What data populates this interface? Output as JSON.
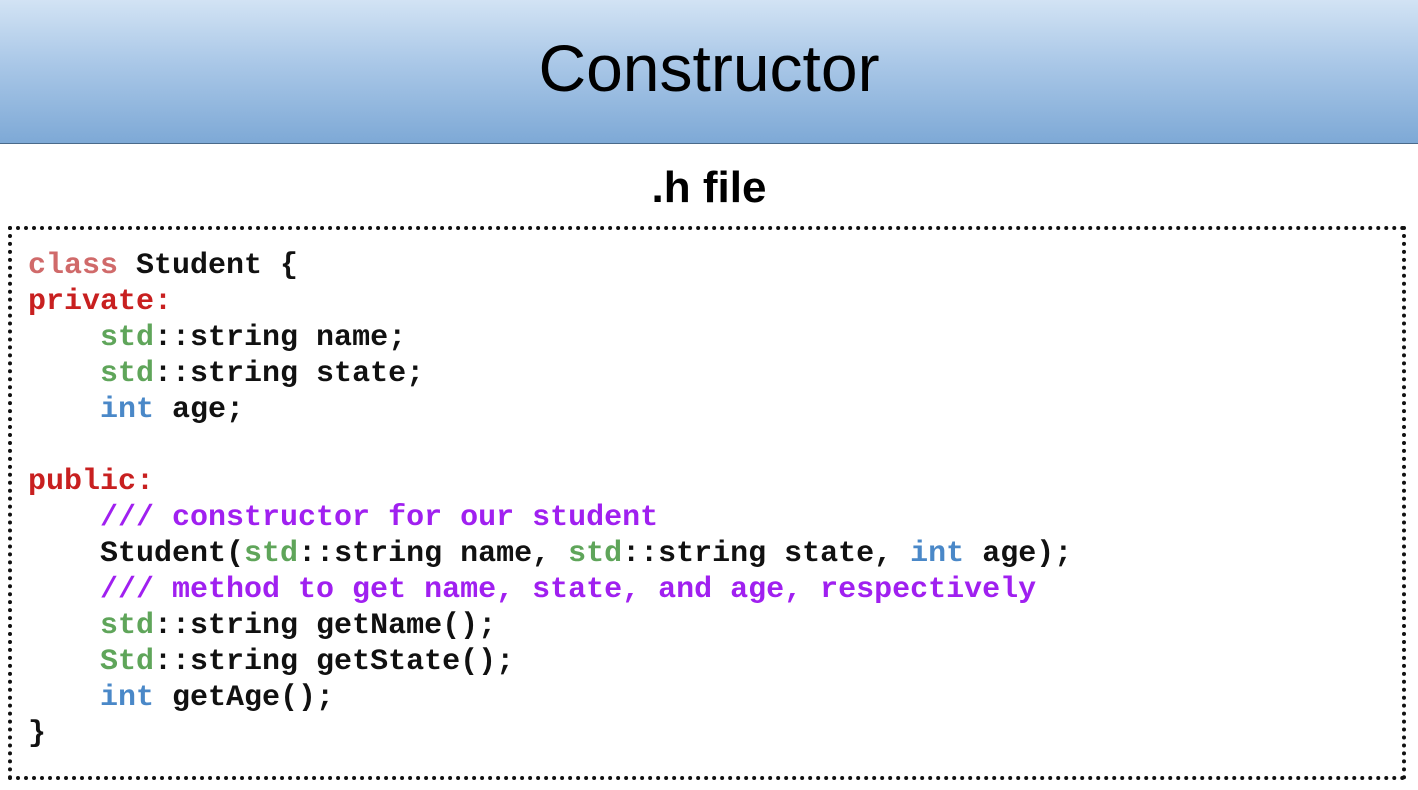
{
  "slide": {
    "title": "Constructor",
    "subtitle": ".h file"
  },
  "colors": {
    "keyword": "#d06a6a",
    "access": "#c82020",
    "namespace": "#5fa55a",
    "type": "#4a88c8",
    "comment": "#a020f0",
    "plain": "#111111"
  },
  "code_lines": [
    [
      {
        "t": "class",
        "k": "keyword"
      },
      {
        "t": " Student {",
        "k": "plain"
      }
    ],
    [
      {
        "t": "private:",
        "k": "access"
      }
    ],
    [
      {
        "t": "    ",
        "k": "plain"
      },
      {
        "t": "std",
        "k": "ns"
      },
      {
        "t": "::string name;",
        "k": "plain"
      }
    ],
    [
      {
        "t": "    ",
        "k": "plain"
      },
      {
        "t": "std",
        "k": "ns"
      },
      {
        "t": "::string state;",
        "k": "plain"
      }
    ],
    [
      {
        "t": "    ",
        "k": "plain"
      },
      {
        "t": "int",
        "k": "type"
      },
      {
        "t": " age;",
        "k": "plain"
      }
    ],
    [],
    [
      {
        "t": "public:",
        "k": "access"
      }
    ],
    [
      {
        "t": "    ",
        "k": "plain"
      },
      {
        "t": "/// constructor for our student",
        "k": "comment"
      }
    ],
    [
      {
        "t": "    Student(",
        "k": "plain"
      },
      {
        "t": "std",
        "k": "ns"
      },
      {
        "t": "::string name, ",
        "k": "plain"
      },
      {
        "t": "std",
        "k": "ns"
      },
      {
        "t": "::string state, ",
        "k": "plain"
      },
      {
        "t": "int",
        "k": "type"
      },
      {
        "t": " age);",
        "k": "plain"
      }
    ],
    [
      {
        "t": "    ",
        "k": "plain"
      },
      {
        "t": "/// method to get name, state, and age, respectively",
        "k": "comment"
      }
    ],
    [
      {
        "t": "    ",
        "k": "plain"
      },
      {
        "t": "std",
        "k": "ns"
      },
      {
        "t": "::string getName();",
        "k": "plain"
      }
    ],
    [
      {
        "t": "    ",
        "k": "plain"
      },
      {
        "t": "Std",
        "k": "ns"
      },
      {
        "t": "::string getState();",
        "k": "plain"
      }
    ],
    [
      {
        "t": "    ",
        "k": "plain"
      },
      {
        "t": "int",
        "k": "type"
      },
      {
        "t": " getAge();",
        "k": "plain"
      }
    ],
    [
      {
        "t": "}",
        "k": "plain"
      }
    ]
  ]
}
